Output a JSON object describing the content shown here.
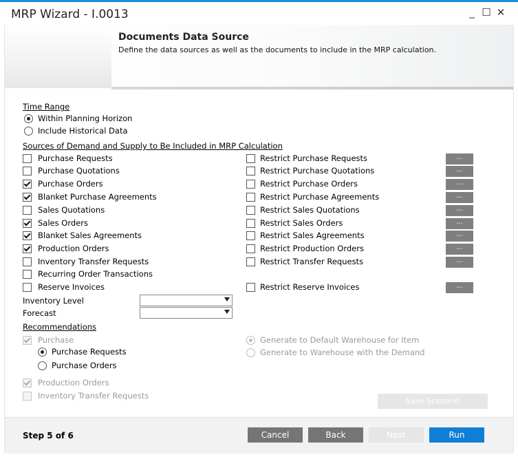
{
  "window": {
    "title": "MRP Wizard - I.0013",
    "minimize": "_",
    "maximize": "☐",
    "close": "✕"
  },
  "header": {
    "title": "Documents Data Source",
    "description": "Define the data sources as well as the documents to include in the MRP calculation."
  },
  "time_range": {
    "title": "Time Range",
    "options": [
      {
        "label": "Within Planning Horizon",
        "selected": true
      },
      {
        "label": "Include Historical Data",
        "selected": false
      }
    ]
  },
  "sources": {
    "title": "Sources of Demand and Supply to Be Included in MRP Calculation",
    "items": [
      {
        "label": "Purchase Requests",
        "checked": false
      },
      {
        "label": "Purchase Quotations",
        "checked": false
      },
      {
        "label": "Purchase Orders",
        "checked": true
      },
      {
        "label": "Blanket Purchase Agreements",
        "checked": true
      },
      {
        "label": "Sales Quotations",
        "checked": false
      },
      {
        "label": "Sales Orders",
        "checked": true
      },
      {
        "label": "Blanket Sales Agreements",
        "checked": true
      },
      {
        "label": "Production Orders",
        "checked": true
      },
      {
        "label": "Inventory Transfer Requests",
        "checked": false
      },
      {
        "label": "Recurring Order Transactions",
        "checked": false
      },
      {
        "label": "Reserve Invoices",
        "checked": false
      }
    ],
    "restrict": [
      {
        "label": "Restrict Purchase Requests",
        "checked": false
      },
      {
        "label": "Restrict Purchase Quotations",
        "checked": false
      },
      {
        "label": "Restrict Purchase Orders",
        "checked": false
      },
      {
        "label": "Restrict Purchase Agreements",
        "checked": false
      },
      {
        "label": "Restrict Sales Quotations",
        "checked": false
      },
      {
        "label": "Restrict Sales Orders",
        "checked": false
      },
      {
        "label": "Restrict Sales Agreements",
        "checked": false
      },
      {
        "label": "Restrict Production Orders",
        "checked": false
      },
      {
        "label": "Restrict Transfer Requests",
        "checked": false
      },
      {
        "label": "Restrict Reserve Invoices",
        "checked": false
      }
    ],
    "dots_label": "..."
  },
  "inventory_level": {
    "label": "Inventory Level",
    "value": ""
  },
  "forecast": {
    "label": "Forecast",
    "value": ""
  },
  "recommendations": {
    "title": "Recommendations",
    "purchase": {
      "label": "Purchase",
      "checked": true
    },
    "purchase_options": [
      {
        "label": "Purchase Requests",
        "selected": true
      },
      {
        "label": "Purchase Orders",
        "selected": false
      }
    ],
    "warehouse_options": [
      {
        "label": "Generate to Default Warehouse for Item",
        "selected": true
      },
      {
        "label": "Generate to Warehouse with the Demand",
        "selected": false
      }
    ],
    "production_orders": {
      "label": "Production Orders",
      "checked": true
    },
    "inventory_transfer_requests": {
      "label": "Inventory Transfer Requests",
      "checked": false
    }
  },
  "save_scenario": "Save Scenario",
  "footer": {
    "step": "Step 5 of 6",
    "cancel": "Cancel",
    "back": "Back",
    "next": "Next",
    "run": "Run"
  },
  "colors": {
    "accent": "#0f7fd6",
    "button_gray": "#757575",
    "title_line": "#1e8fdc"
  }
}
